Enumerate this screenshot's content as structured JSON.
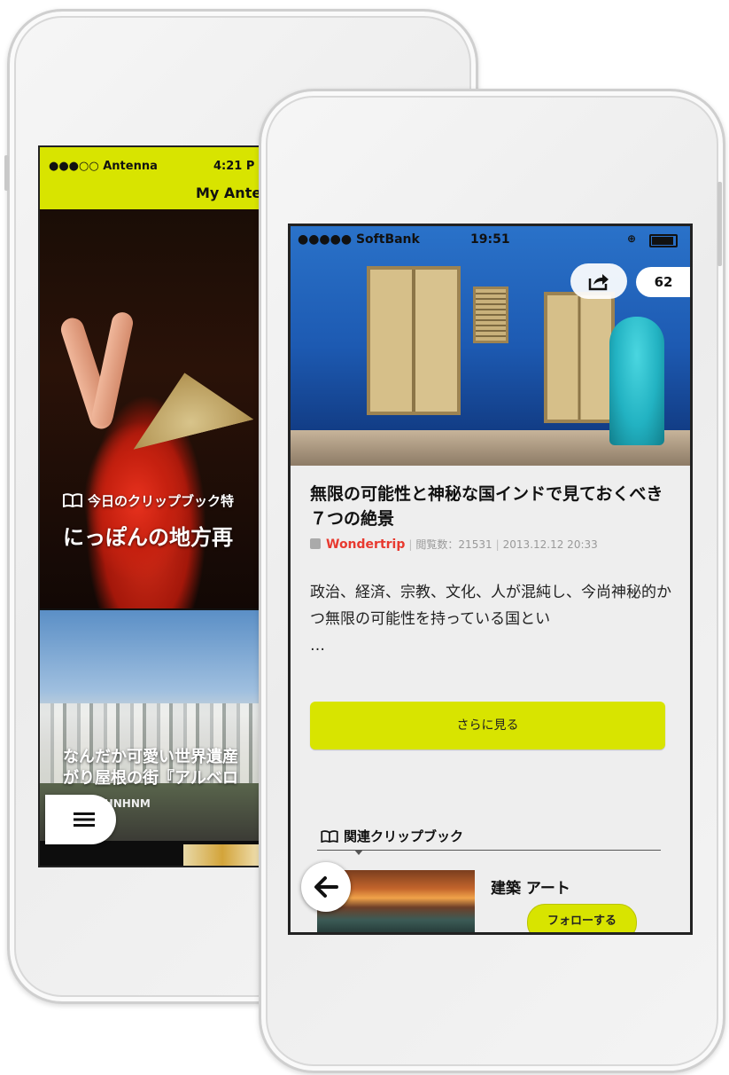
{
  "back_screen": {
    "status": {
      "carrier": "●●●○○ Antenna",
      "time": "4:21 P"
    },
    "header_title": "My Ante",
    "clip_label": "今日のクリップブック特",
    "clip_title": "にっぽんの地方再",
    "card2_title": "なんだか可愛い世界遺産\nがり屋根の街『アルベロ",
    "card2_user": "YHNHNM"
  },
  "front_screen": {
    "status": {
      "carrier": "●●●●● SoftBank",
      "time": "19:51"
    },
    "share_count": "62",
    "article": {
      "title": "無限の可能性と神秘な国インドで見ておくべき７つの絶景",
      "source": "Wondertrip",
      "views": "閲覧数：21531",
      "date": "2013.12.12  20:33",
      "excerpt": "政治、経済、宗教、文化、人が混純し、今尚神秘的かつ無限の可能性を持っている国とい\n…"
    },
    "more_label": "さらに見る",
    "related": {
      "header": "関連クリップブック",
      "item_name": "建築 アート",
      "follow_label": "フォローする"
    }
  },
  "colors": {
    "accent": "#d8e400",
    "source_red": "#e8392f"
  }
}
